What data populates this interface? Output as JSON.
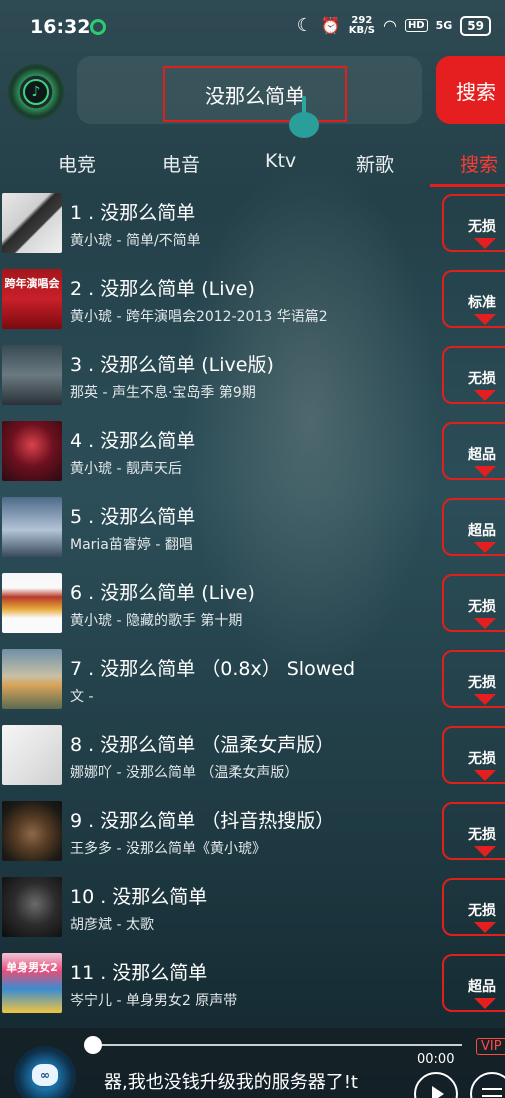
{
  "status_bar": {
    "time": "16:32",
    "net_speed_value": "292",
    "net_speed_unit": "KB/S",
    "hd": "HD",
    "signal": "5G",
    "battery": "59"
  },
  "header": {
    "search_query": "没那么简单",
    "search_button": "搜索"
  },
  "tabs": [
    {
      "label": "电竞"
    },
    {
      "label": "电音"
    },
    {
      "label": "Ktv"
    },
    {
      "label": "新歌"
    },
    {
      "label": "搜索",
      "active": true
    }
  ],
  "songs": [
    {
      "title": "1 . 没那么简单",
      "subtitle": "黄小琥 - 简单/不简单",
      "quality": "无损"
    },
    {
      "title": "2 . 没那么简单 (Live)",
      "subtitle": "黄小琥 - 跨年演唱会2012-2013 华语篇2",
      "quality": "标准"
    },
    {
      "title": "3 . 没那么简单 (Live版)",
      "subtitle": "那英 - 声生不息·宝岛季 第9期",
      "quality": "无损"
    },
    {
      "title": "4 . 没那么简单",
      "subtitle": "黄小琥 - 靓声天后",
      "quality": "超品"
    },
    {
      "title": "5 . 没那么简单",
      "subtitle": "Maria苗睿婷 - 翻唱",
      "quality": "超品"
    },
    {
      "title": "6 . 没那么简单 (Live)",
      "subtitle": "黄小琥 - 隐藏的歌手 第十期",
      "quality": "无损"
    },
    {
      "title": "7 . 没那么简单 （0.8x） Slowed",
      "subtitle": "文 -",
      "quality": "无损"
    },
    {
      "title": "8 . 没那么简单 （温柔女声版）",
      "subtitle": "娜娜吖 - 没那么简单 （温柔女声版）",
      "quality": "无损"
    },
    {
      "title": "9 . 没那么简单 （抖音热搜版）",
      "subtitle": "王多多 - 没那么简单《黄小琥》",
      "quality": "无损"
    },
    {
      "title": "10 . 没那么简单",
      "subtitle": "胡彦斌 - 太歌",
      "quality": "无损"
    },
    {
      "title": "11 . 没那么简单",
      "subtitle": "岑宁儿 - 单身男女2 原声带",
      "quality": "超品"
    }
  ],
  "thumb_labels": {
    "t2": "跨年演唱会",
    "t11": "单身男女2"
  },
  "player": {
    "vip": "VIP",
    "time": "00:00",
    "ticker": "器,我也没钱升级我的服务器了!t"
  },
  "colors": {
    "accent_red": "#e51f1f",
    "brand_green": "#3cd37a"
  }
}
